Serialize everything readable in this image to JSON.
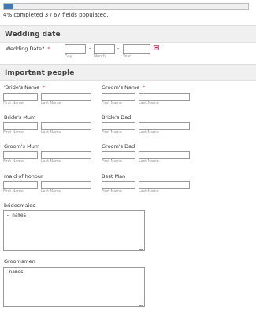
{
  "progress": {
    "percent": 4,
    "text": "4% completed   3 / 67 fields populated."
  },
  "sections": {
    "wedding_date": "Wedding date",
    "important_people": "Important people"
  },
  "date": {
    "label": "Wedding Date?",
    "req": "*",
    "sep1": "-",
    "sep2": "-",
    "day": "Day",
    "month": "Month",
    "year": "Year"
  },
  "sub": {
    "first": "First Name",
    "last": "Last Name"
  },
  "people": {
    "bride": "'Bride's Name",
    "bride_req": "*",
    "groom": "Groom's Name",
    "groom_req": "*",
    "brides_mum": "Bride's Mum",
    "brides_dad": "Bride's Dad",
    "grooms_mum": "Groom's Mum",
    "grooms_dad": "Groom's Dad",
    "maid": "maid of honour",
    "best_man": "Best Man"
  },
  "bridesmaids": {
    "label": "bridesmaids",
    "value": "- names"
  },
  "groomsmen": {
    "label": "Groomsmen",
    "value": "-names"
  },
  "colors": {
    "accent": "#3f78b5"
  }
}
